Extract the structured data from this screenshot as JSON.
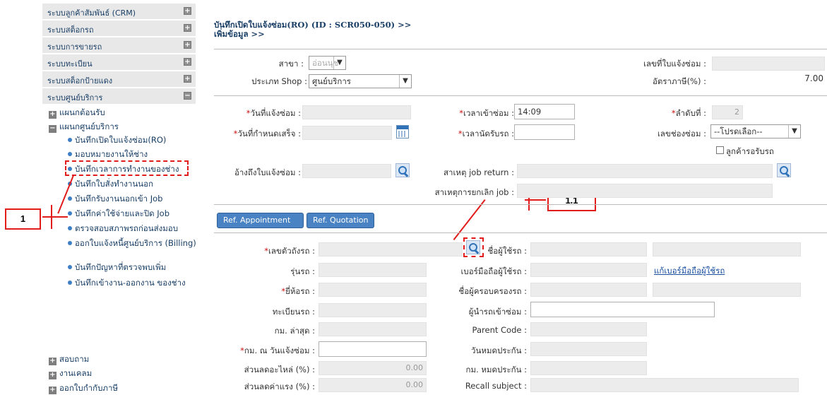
{
  "sidebar": {
    "menu": [
      {
        "label": "ระบบลูกค้าสัมพันธ์ (CRM)",
        "toggle": "+"
      },
      {
        "label": "ระบบสต็อกรถ",
        "toggle": "+"
      },
      {
        "label": "ระบบการขายรถ",
        "toggle": "+"
      },
      {
        "label": "ระบบทะเบียน",
        "toggle": "+"
      },
      {
        "label": "ระบบสต็อกป้ายแดง",
        "toggle": "+"
      },
      {
        "label": "ระบบศูนย์บริการ",
        "toggle": "−"
      }
    ],
    "tree": {
      "reception": "แผนกต้อนรับ",
      "service": "แผนกศูนย์บริการ",
      "inquiry": "สอบถาม",
      "claim": "งานเคลม",
      "tax_invoice": "ออกใบกำกับภาษี"
    },
    "service_items": [
      "บันทึกเปิดใบแจ้งซ่อม(RO)",
      "มอบหมายงานให้ช่าง",
      "บันทึกเวลาการทำงานของช่าง",
      "บันทึกใบสั่งทำงานนอก",
      "บันทึกรับงานนอกเข้า Job",
      "บันทึกค่าใช้จ่ายและปิด Job",
      "ตรวจสอบสภาพรถก่อนส่งมอบ",
      "ออกใบแจ้งหนี้ศูนย์บริการ (Billing)",
      "บันทึกปัญหาที่ตรวจพบเพิ่ม",
      "บันทึกเข้างาน-ออกงาน ของช่าง"
    ]
  },
  "header": {
    "title_line1": "บันทึกเปิดใบแจ้งซ่อม(RO) (ID : SCR050-050)  >>",
    "title_line2": "เพิ่มข้อมูล >>"
  },
  "form": {
    "branch_label": "สาขา :",
    "branch_value": "อ่อนนุช",
    "ro_number_label": "เลขที่ใบแจ้งซ่อม :",
    "shop_type_label": "ประเภท Shop :",
    "shop_type_value": "ศูนย์บริการ",
    "vat_label": "อัตราภาษี(%) :",
    "vat_value": "7.00",
    "notify_date_label": "วันที่แจ้งซ่อม :",
    "time_in_label": "เวลาเข้าซ่อม :",
    "time_in_value": "14:09",
    "seq_label": "ลำดับที่ :",
    "seq_value": "2",
    "due_date_label": "วันที่กำหนดเสร็จ :",
    "pickup_time_label": "เวลานัดรับรถ :",
    "bay_label": "เลขช่องซ่อม :",
    "bay_value": "--โปรดเลือก--",
    "customer_wait_label": "ลูกค้ารอรับรถ",
    "ref_ro_label": "อ้างถึงใบแจ้งซ่อม :",
    "job_return_label": "สาเหตุ job return :",
    "cancel_reason_label": "สาเหตุการยกเลิก job :"
  },
  "buttons": {
    "ref_appointment": "Ref. Appointment",
    "ref_quotation": "Ref. Quotation"
  },
  "vehicle": {
    "chassis_label": "เลขตัวถังรถ :",
    "user_name_label": "ชื่อผู้ใช้รถ :",
    "model_label": "รุ่นรถ :",
    "user_mobile_label": "เบอร์มือถือผู้ใช้รถ :",
    "edit_mobile_link": "แก้เบอร์มือถือผู้ใช้รถ",
    "brand_label": "ยี่ห้อรถ :",
    "owner_label": "ชื่อผู้ครอบครองรถ :",
    "plate_label": "ทะเบียนรถ :",
    "driver_label": "ผู้นำรถเข้าซ่อม :",
    "last_km_label": "กม. ล่าสุด :",
    "parent_code_label": "Parent Code :",
    "km_at_notify_label": "กม. ณ วันแจ้งซ่อม :",
    "warranty_end_label": "วันหมดประกัน :",
    "parts_discount_label": "ส่วนลดอะไหล่ (%) :",
    "parts_discount_value": "0.00",
    "warranty_km_label": "กม. หมดประกัน :",
    "labor_discount_label": "ส่วนลดค่าแรง (%) :",
    "labor_discount_value": "0.00",
    "recall_label": "Recall subject :"
  },
  "annotations": {
    "callout_1": "1",
    "callout_1_1": "1.1"
  },
  "colors": {
    "accent_red": "#e21b1b",
    "button_blue": "#4a83c3",
    "link_blue": "#1a4fa0",
    "required_red": "#cc1111"
  }
}
